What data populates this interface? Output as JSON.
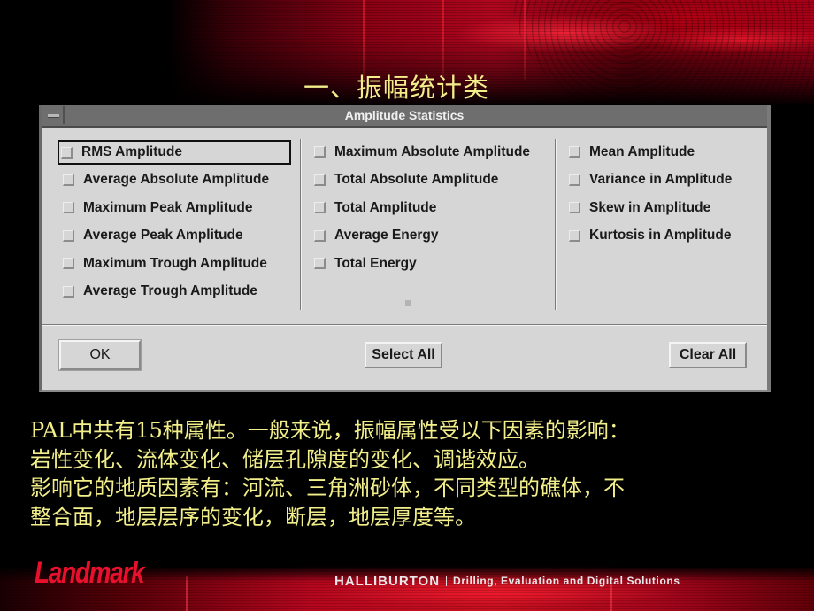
{
  "slide": {
    "title": "一、振幅统计类",
    "body_lines": [
      "PAL中共有15种属性。一般来说，振幅属性受以下因素的影响：",
      "岩性变化、流体变化、储层孔隙度的变化、调谐效应。",
      "影响它的地质因素有：河流、三角洲砂体，不同类型的礁体，不",
      "整合面，地层层序的变化，断层，地层厚度等。"
    ],
    "colors": {
      "text": "#f2ee8a",
      "background": "#000000",
      "accent_red": "#e8102c"
    }
  },
  "dialog": {
    "title": "Amplitude Statistics",
    "system_menu_icon": "window-menu-icon",
    "columns": [
      {
        "options": [
          {
            "label": "RMS Amplitude",
            "checked": false,
            "focused": true
          },
          {
            "label": "Average Absolute Amplitude",
            "checked": false
          },
          {
            "label": "Maximum Peak Amplitude",
            "checked": false
          },
          {
            "label": "Average Peak Amplitude",
            "checked": false
          },
          {
            "label": "Maximum Trough Amplitude",
            "checked": false
          },
          {
            "label": "Average Trough Amplitude",
            "checked": false
          }
        ]
      },
      {
        "options": [
          {
            "label": "Maximum Absolute Amplitude",
            "checked": false
          },
          {
            "label": "Total Absolute Amplitude",
            "checked": false
          },
          {
            "label": "Total Amplitude",
            "checked": false
          },
          {
            "label": "Average Energy",
            "checked": false
          },
          {
            "label": "Total Energy",
            "checked": false
          }
        ]
      },
      {
        "options": [
          {
            "label": "Mean Amplitude",
            "checked": false
          },
          {
            "label": "Variance in Amplitude",
            "checked": false
          },
          {
            "label": "Skew in Amplitude",
            "checked": false
          },
          {
            "label": "Kurtosis in Amplitude",
            "checked": false
          }
        ]
      }
    ],
    "buttons": {
      "ok": "OK",
      "select_all": "Select All",
      "clear_all": "Clear All"
    }
  },
  "footer": {
    "logo": "Landmark",
    "brand": "HALLIBURTON",
    "tagline": "Drilling, Evaluation and Digital Solutions"
  }
}
